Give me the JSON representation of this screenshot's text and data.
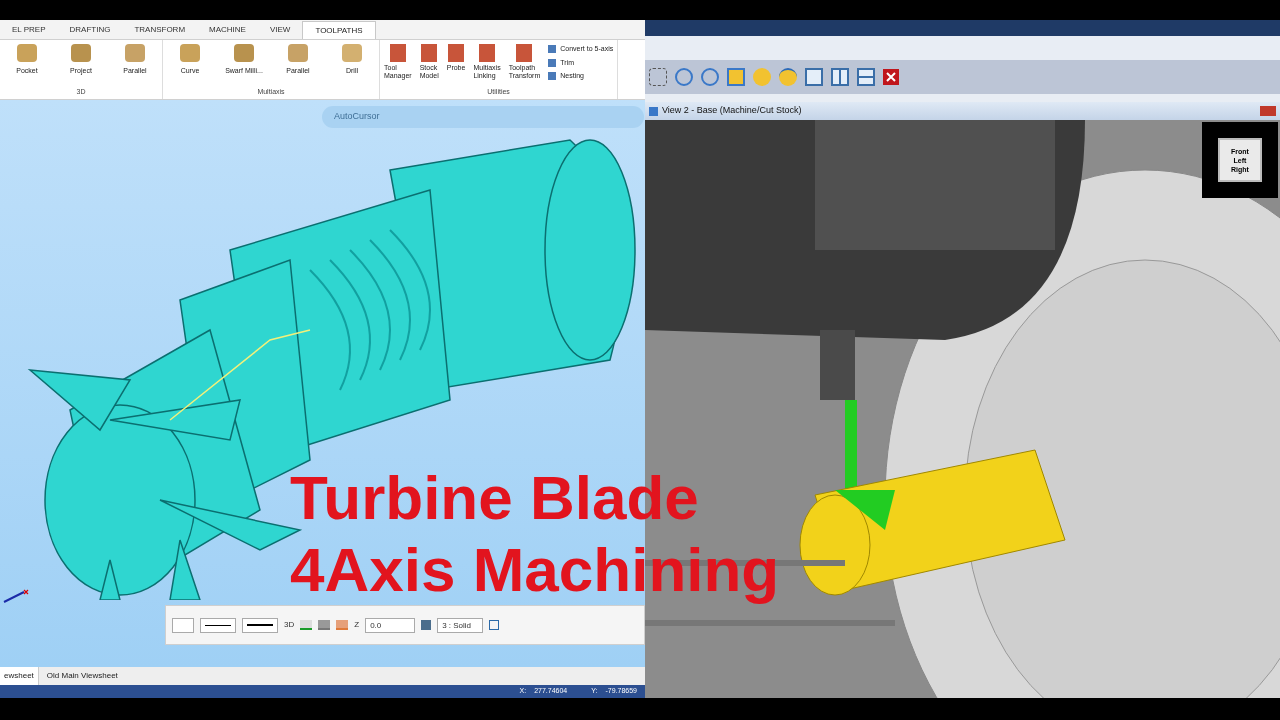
{
  "ribbon": {
    "tabs": [
      {
        "label": "EL PREP",
        "selected": false
      },
      {
        "label": "DRAFTING",
        "selected": false
      },
      {
        "label": "TRANSFORM",
        "selected": false
      },
      {
        "label": "MACHINE",
        "selected": false
      },
      {
        "label": "VIEW",
        "selected": false
      },
      {
        "label": "TOOLPATHS",
        "selected": true
      }
    ],
    "groups": [
      {
        "title": "3D",
        "kind": "gallery",
        "items": [
          "Pocket",
          "Project",
          "Parallel"
        ]
      },
      {
        "title": "Multiaxis",
        "kind": "gallery",
        "items": [
          "Curve",
          "Swarf Milli...",
          "Parallel",
          "Drill"
        ]
      },
      {
        "title": "Utilities",
        "kind": "tools",
        "items": [
          [
            "Tool",
            "Manager"
          ],
          [
            "Stock",
            "Model"
          ],
          [
            "Probe"
          ],
          [
            "Multiaxis",
            "Linking"
          ],
          [
            "Toolpath",
            "Transform"
          ]
        ],
        "small_items": [
          "Convert to 5-axis",
          "Trim",
          "Nesting"
        ]
      }
    ]
  },
  "autocursor": {
    "label": "AutoCursor"
  },
  "bottom_toolbar": {
    "mode": "3D",
    "z_label": "Z",
    "z_value": "0.0",
    "level": "3 : Solid"
  },
  "viewsheets": [
    {
      "label": "ewsheet",
      "selected": true
    },
    {
      "label": "Old Main Viewsheet",
      "selected": false
    }
  ],
  "status_bar": {
    "x_label": "X:",
    "x_value": "277.74604",
    "y_label": "Y:",
    "y_value": "-79.78659"
  },
  "sim_window": {
    "title": "View 2 - Base (Machine/Cut Stock)",
    "cube_labels": [
      "Front",
      "Left",
      "Right"
    ]
  },
  "overlay_title": [
    "Turbine Blade",
    "4Axis Machining"
  ]
}
